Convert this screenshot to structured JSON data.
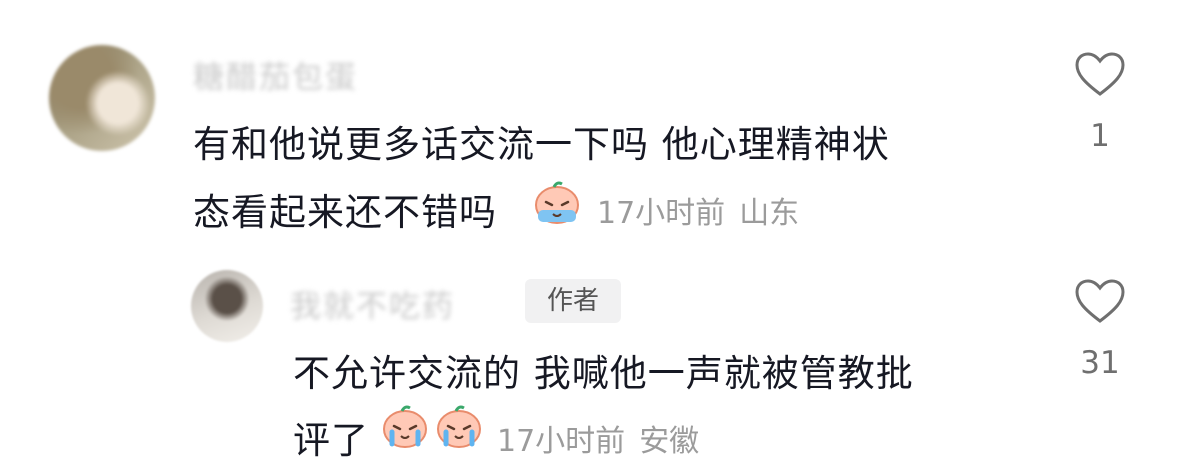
{
  "comments": [
    {
      "username": "糖醋茄包蛋",
      "line1": "有和他说更多话交流一下吗 他心理精神状",
      "line2": "态看起来还不错吗",
      "emoji": "crying-emoji",
      "time": "17小时前",
      "location": "山东",
      "like_count": "1"
    }
  ],
  "reply": {
    "username": "我就不吃药",
    "badge": "作者",
    "line1": "不允许交流的 我喊他一声就被管教批",
    "line2": "评了",
    "emoji": "crying-emoji",
    "time": "17小时前",
    "location": "安徽",
    "like_count": "31"
  },
  "colors": {
    "text": "#161823",
    "meta": "#9b9b9b",
    "badge_bg": "#f1f1f2"
  }
}
